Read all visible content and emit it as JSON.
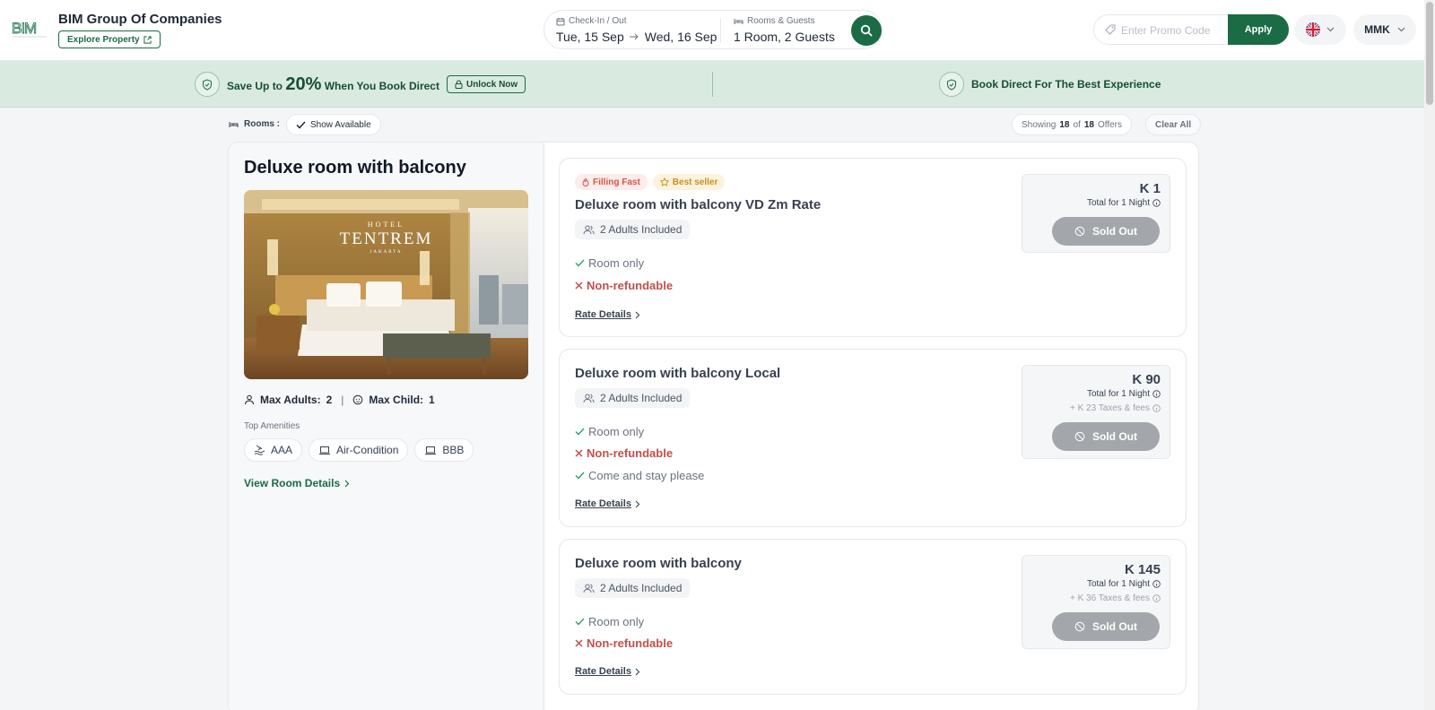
{
  "header": {
    "brand_name": "BIM Group Of Companies",
    "explore_label": "Explore Property",
    "checkin_label": "Check-In / Out",
    "checkin_date": "Tue, 15 Sep",
    "checkout_date": "Wed, 16 Sep",
    "guests_label": "Rooms & Guests",
    "guests_value": "1 Room, 2 Guests",
    "promo_placeholder": "Enter Promo Code",
    "apply_label": "Apply",
    "currency": "MMK",
    "colors": {
      "brand_green": "#1b6b45"
    }
  },
  "banner": {
    "save_prefix": "Save Up to",
    "save_percent": "20%",
    "save_suffix": "When You Book Direct",
    "unlock_label": "Unlock Now",
    "book_direct": "Book Direct For The Best Experience"
  },
  "filters": {
    "rooms_label": "Rooms :",
    "show_available": "Show Available",
    "showing_word": "Showing",
    "shown": "18",
    "of_word": "of",
    "total": "18",
    "offers_word": "Offers",
    "clear_all": "Clear All"
  },
  "room": {
    "title": "Deluxe room with balcony",
    "photo_brand_small": "HOTEL",
    "photo_brand": "TENTREM",
    "photo_brand_sub": "JAKARTA",
    "max_adults_label": "Max Adults:",
    "max_adults": "2",
    "max_child_label": "Max Child:",
    "max_child": "1",
    "amenities_title": "Top Amenities",
    "amenities": [
      "AAA",
      "Air-Condition",
      "BBB"
    ],
    "view_details": "View Room Details"
  },
  "offers": [
    {
      "badges": [
        "Filling Fast",
        "Best seller"
      ],
      "name": "Deluxe room with balcony VD Zm Rate",
      "adults": "2 Adults Included",
      "features": [
        {
          "text": "Room only",
          "ok": true
        },
        {
          "text": "Non-refundable",
          "ok": false
        }
      ],
      "rate_link": "Rate Details",
      "price": "K 1",
      "total": "Total for 1 Night",
      "status": "Sold Out"
    },
    {
      "name": "Deluxe room with balcony Local",
      "adults": "2 Adults Included",
      "features": [
        {
          "text": "Room only",
          "ok": true
        },
        {
          "text": "Non-refundable",
          "ok": false
        },
        {
          "text": "Come and stay please",
          "ok": true
        }
      ],
      "rate_link": "Rate Details",
      "price": "K 90",
      "total": "Total for 1 Night",
      "taxes": "+ K 23 Taxes & fees",
      "status": "Sold Out"
    },
    {
      "name": "Deluxe room with balcony",
      "adults": "2 Adults Included",
      "features": [
        {
          "text": "Room only",
          "ok": true
        },
        {
          "text": "Non-refundable",
          "ok": false
        }
      ],
      "rate_link": "Rate Details",
      "price": "K 145",
      "total": "Total for 1 Night",
      "taxes": "+ K 36 Taxes & fees",
      "status": "Sold Out"
    }
  ]
}
